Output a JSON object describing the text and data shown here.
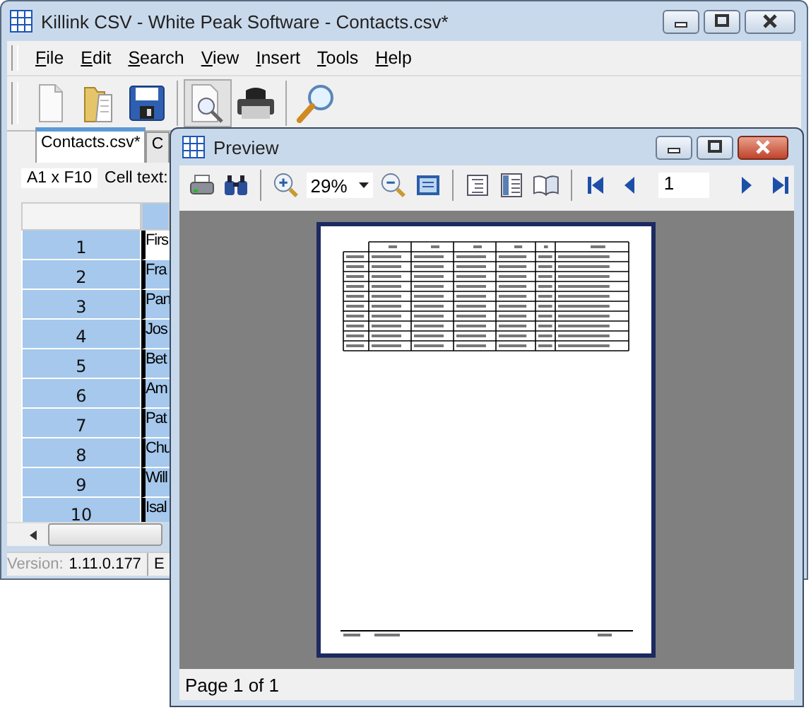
{
  "main_window": {
    "title": "Killink CSV - White Peak Software - Contacts.csv*",
    "menu": [
      {
        "label": "File",
        "underline_first": true
      },
      {
        "label": "Edit",
        "underline_first": true
      },
      {
        "label": "Search",
        "underline_first": true
      },
      {
        "label": "View",
        "underline_first": true
      },
      {
        "label": "Insert",
        "underline_first": true
      },
      {
        "label": "Tools",
        "underline_first": true
      },
      {
        "label": "Help",
        "underline_first": true
      }
    ],
    "toolbar": [
      {
        "kind": "new",
        "pressed": false
      },
      {
        "kind": "open",
        "pressed": false
      },
      {
        "kind": "save",
        "pressed": false
      },
      {
        "kind": "separator"
      },
      {
        "kind": "preview",
        "pressed": true
      },
      {
        "kind": "print",
        "pressed": false
      },
      {
        "kind": "separator"
      },
      {
        "kind": "find",
        "pressed": false
      }
    ],
    "tabs": [
      {
        "label": "Contacts.csv*",
        "selected": true
      },
      {
        "label": "C",
        "selected": false
      }
    ],
    "cell_bar": {
      "range": "A1 x F10",
      "label": "Cell text:"
    },
    "rows": [
      {
        "number": "1",
        "cell": "Firs",
        "selected": false
      },
      {
        "number": "2",
        "cell": "Fra",
        "selected": true
      },
      {
        "number": "3",
        "cell": "Pan",
        "selected": true
      },
      {
        "number": "4",
        "cell": "Jos",
        "selected": true
      },
      {
        "number": "5",
        "cell": "Bet",
        "selected": true
      },
      {
        "number": "6",
        "cell": "Am",
        "selected": true
      },
      {
        "number": "7",
        "cell": "Pat",
        "selected": true
      },
      {
        "number": "8",
        "cell": "Chu",
        "selected": true
      },
      {
        "number": "9",
        "cell": "Will",
        "selected": true
      },
      {
        "number": "10",
        "cell": "Isal",
        "selected": true
      }
    ],
    "status_bar": {
      "label": "Version:",
      "version": "1.11.0.177",
      "next": "E"
    }
  },
  "preview_window": {
    "title": "Preview",
    "toolbar": [
      {
        "kind": "print"
      },
      {
        "kind": "find"
      },
      {
        "kind": "separator"
      },
      {
        "kind": "zoom-in"
      },
      {
        "kind": "zoom-select",
        "value": "29%"
      },
      {
        "kind": "zoom-out"
      },
      {
        "kind": "fit"
      },
      {
        "kind": "separator"
      },
      {
        "kind": "page-setup"
      },
      {
        "kind": "columns"
      },
      {
        "kind": "book"
      },
      {
        "kind": "separator"
      },
      {
        "kind": "first"
      },
      {
        "kind": "prev"
      },
      {
        "kind": "page-field",
        "value": "1"
      },
      {
        "kind": "next"
      },
      {
        "kind": "last"
      }
    ],
    "status_bar": "Page 1 of 1"
  }
}
